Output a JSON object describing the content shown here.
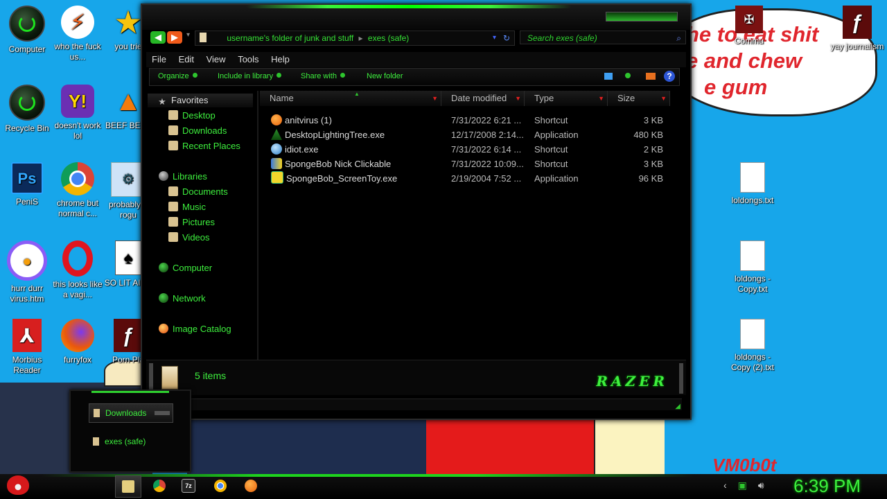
{
  "wallpaper": {
    "bubble_line1": "he to eat shit",
    "bubble_line2": "e and chew",
    "bubble_line3": "e gum",
    "corner_text": "VM0b0t"
  },
  "desktop_icons": [
    {
      "label": "Computer",
      "icon": "green-orb"
    },
    {
      "label": "who the fuck us...",
      "icon": "flash"
    },
    {
      "label": "you trie",
      "icon": "star"
    },
    {
      "label": "Recycle Bin",
      "icon": "green-orb"
    },
    {
      "label": "doesn't work lol",
      "icon": "yahoo"
    },
    {
      "label": "BEEF BEEF",
      "icon": "cone"
    },
    {
      "label": "PeniS",
      "icon": "ps"
    },
    {
      "label": "chrome but normal c...",
      "icon": "chrome"
    },
    {
      "label": "probably a rogu",
      "icon": "probably"
    },
    {
      "label": "hurr durr virus.htm",
      "icon": "privacy"
    },
    {
      "label": "this looks like a vagi...",
      "icon": "opera"
    },
    {
      "label": "SO LIT AIRE",
      "icon": "card"
    },
    {
      "label": "Morbius Reader",
      "icon": "pdf"
    },
    {
      "label": "furryfox",
      "icon": "firefox"
    },
    {
      "label": "Porn Pla",
      "icon": "flash-dark"
    },
    {
      "label": "Commu",
      "icon": "seal"
    },
    {
      "label": "yay journalism",
      "icon": "flash-dark"
    },
    {
      "label": "loldongs.txt",
      "icon": "text-file"
    },
    {
      "label": "loldongs - Copy.txt",
      "icon": "text-file"
    },
    {
      "label": "loldongs - Copy (2).txt",
      "icon": "text-file"
    }
  ],
  "explorer": {
    "address": {
      "parent": "username's folder of junk and stuff",
      "current": "exes (safe)"
    },
    "search_placeholder": "Search exes (safe)",
    "menu": [
      "File",
      "Edit",
      "View",
      "Tools",
      "Help"
    ],
    "commands": [
      "Organize",
      "Include in library",
      "Share with",
      "New folder"
    ],
    "nav": {
      "favorites_header": "Favorites",
      "favorites": [
        "Desktop",
        "Downloads",
        "Recent Places"
      ],
      "libraries_header": "Libraries",
      "libraries": [
        "Documents",
        "Music",
        "Pictures",
        "Videos"
      ],
      "computer": "Computer",
      "network": "Network",
      "image_catalog": "Image Catalog"
    },
    "columns": [
      "Name",
      "Date modified",
      "Type",
      "Size"
    ],
    "files": [
      {
        "name": "anitvirus (1)",
        "date": "7/31/2022 6:21 ...",
        "type": "Shortcut",
        "size": "3 KB",
        "icon": "avast"
      },
      {
        "name": "DesktopLightingTree.exe",
        "date": "12/17/2008 2:14...",
        "type": "Application",
        "size": "480 KB",
        "icon": "tree"
      },
      {
        "name": "idiot.exe",
        "date": "7/31/2022 6:14 ...",
        "type": "Shortcut",
        "size": "2 KB",
        "icon": "idiot"
      },
      {
        "name": "SpongeBob Nick Clickable",
        "date": "7/31/2022 10:09...",
        "type": "Shortcut",
        "size": "3 KB",
        "icon": "spongebob-nick"
      },
      {
        "name": "SpongeBob_ScreenToy.exe",
        "date": "2/19/2004 7:52 ...",
        "type": "Application",
        "size": "96 KB",
        "icon": "spongebob"
      }
    ],
    "item_count": "5 items",
    "brand": "RAZER"
  },
  "preview_popup": {
    "items": [
      "Downloads",
      "exes (safe)"
    ]
  },
  "taskbar": {
    "clock": "6:39 PM"
  },
  "colors": {
    "accent": "#3ef03e",
    "window_bg": "#000000",
    "desktop": "#17a6ea"
  }
}
